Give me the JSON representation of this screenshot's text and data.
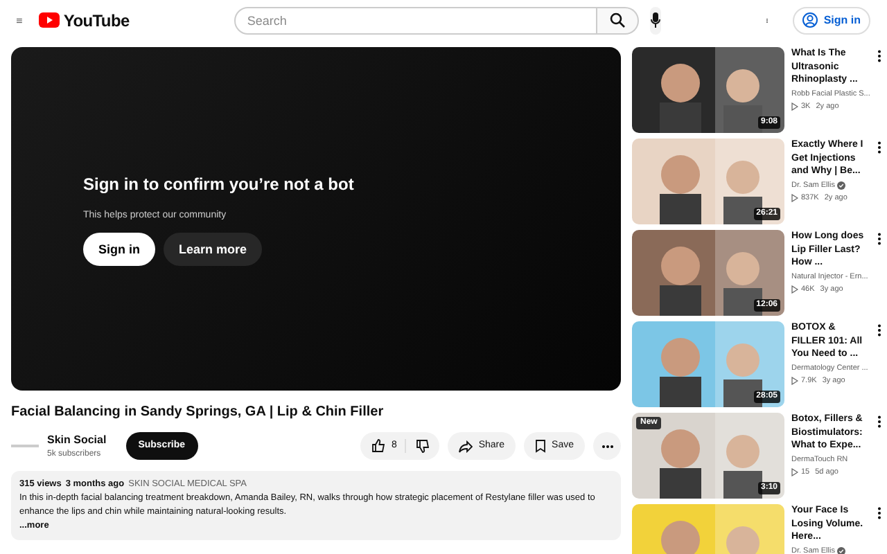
{
  "header": {
    "logo": "YouTube",
    "search": {
      "placeholder": "Search"
    },
    "sign_in": "Sign in"
  },
  "player": {
    "heading": "Sign in to confirm you’re not a bot",
    "subtext": "This helps protect our community",
    "buttons": [
      {
        "label": "Sign in",
        "kind": "primary"
      },
      {
        "label": "Learn more",
        "kind": "secondary"
      }
    ]
  },
  "video": {
    "title": "Facial Balancing in Sandy Springs, GA | Lip & Chin Filler",
    "channel": "Skin Social",
    "subscribers": "5k subscribers",
    "subscribe": "Subscribe",
    "likes": "8",
    "share": "Share",
    "save": "Save"
  },
  "description": {
    "views": "315 views",
    "age": "3 months ago",
    "tag": "SKIN SOCIAL MEDICAL SPA",
    "text": "In this in-depth facial balancing treatment breakdown, Amanda Bailey, RN, walks through how strategic placement of Restylane filler was used to enhance the lips and chin while maintaining natural-looking results.",
    "more": "...more"
  },
  "related": [
    {
      "title": "What Is The Ultrasonic Rhinoplasty ...",
      "channel": "Robb Facial Plastic S...",
      "verified": false,
      "views": "3K",
      "age": "2y ago",
      "duration": "9:08"
    },
    {
      "title": "Exactly Where I Get Injections and Why | Be...",
      "channel": "Dr. Sam Ellis",
      "verified": true,
      "views": "837K",
      "age": "2y ago",
      "duration": "26:21"
    },
    {
      "title": "How Long does Lip Filler Last? How ...",
      "channel": "Natural Injector - Ern...",
      "verified": false,
      "views": "46K",
      "age": "3y ago",
      "duration": "12:06"
    },
    {
      "title": "BOTOX & FILLER 101: All You Need to ...",
      "channel": "Dermatology Center ...",
      "verified": false,
      "views": "7.9K",
      "age": "3y ago",
      "duration": "28:05"
    },
    {
      "title": "Botox, Fillers & Biostimulators: What to Expe...",
      "channel": "DermaTouch RN",
      "verified": false,
      "views": "15",
      "age": "5d ago",
      "duration": "3:10",
      "badge": "New"
    },
    {
      "title": "Your Face Is Losing Volume. Here...",
      "channel": "Dr. Sam Ellis",
      "verified": true
    }
  ]
}
